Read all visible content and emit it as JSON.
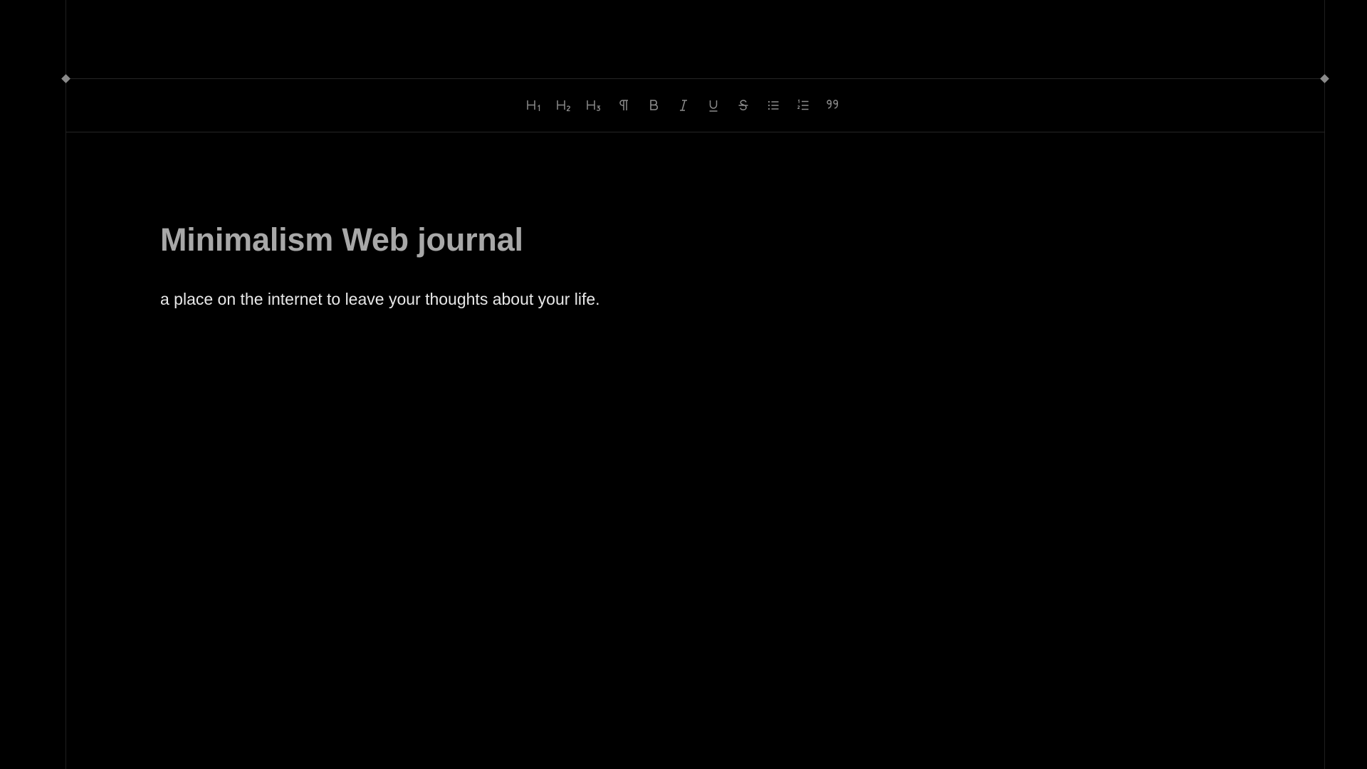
{
  "editor": {
    "title": "Minimalism Web journal",
    "body": "a place on the internet to leave your thoughts about your life."
  },
  "toolbar": {
    "tools": [
      {
        "name": "heading-1",
        "icon": "heading-1-icon"
      },
      {
        "name": "heading-2",
        "icon": "heading-2-icon"
      },
      {
        "name": "heading-3",
        "icon": "heading-3-icon"
      },
      {
        "name": "paragraph",
        "icon": "pilcrow-icon"
      },
      {
        "name": "bold",
        "icon": "bold-icon"
      },
      {
        "name": "italic",
        "icon": "italic-icon"
      },
      {
        "name": "underline",
        "icon": "underline-icon"
      },
      {
        "name": "strikethrough",
        "icon": "strikethrough-icon"
      },
      {
        "name": "bullet-list",
        "icon": "bullet-list-icon"
      },
      {
        "name": "ordered-list",
        "icon": "ordered-list-icon"
      },
      {
        "name": "blockquote",
        "icon": "quote-icon"
      }
    ]
  },
  "colors": {
    "background": "#000000",
    "title": "#a8a8a8",
    "body": "#e8e8e8",
    "icon": "#8c8c8c",
    "frame": "#262626"
  }
}
